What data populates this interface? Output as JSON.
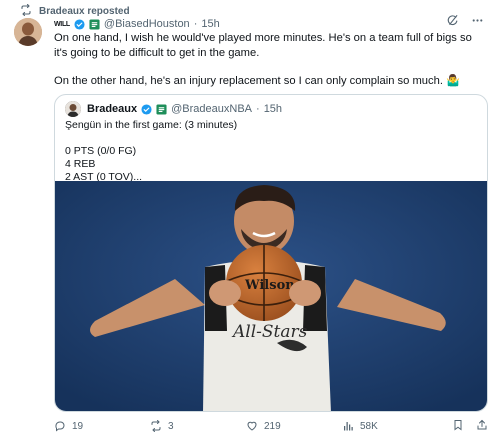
{
  "repost_banner": {
    "text": "Bradeaux reposted",
    "icon": "repost-icon"
  },
  "tweet": {
    "author_wordmark": "WILL",
    "handle": "@BiasedHouston",
    "time": "15h",
    "paragraphs": [
      "On one hand, I wish he would've played more minutes. He's on a team full of bigs so it's going to be difficult to get in the game.",
      "On the other hand, he's an injury replacement so I can only complain so much. 🤷‍♂️"
    ]
  },
  "quote": {
    "name": "Bradeaux",
    "handle": "@BradeauxNBA",
    "time": "15h",
    "lines": [
      "Şengün in the first game: (3 minutes)",
      "",
      "0 PTS (0/0 FG)",
      "4 REB",
      "2 AST (0 TOV)..."
    ],
    "image_text": {
      "ball": "Wilson",
      "jersey": "All-Stars"
    }
  },
  "actions": {
    "replies": "19",
    "reposts": "3",
    "likes": "219",
    "views": "58K"
  },
  "colors": {
    "verified": "#1d9bf0",
    "secondary": "#536471",
    "border": "#cfd9de",
    "backdrop": "#1f3f6a"
  }
}
